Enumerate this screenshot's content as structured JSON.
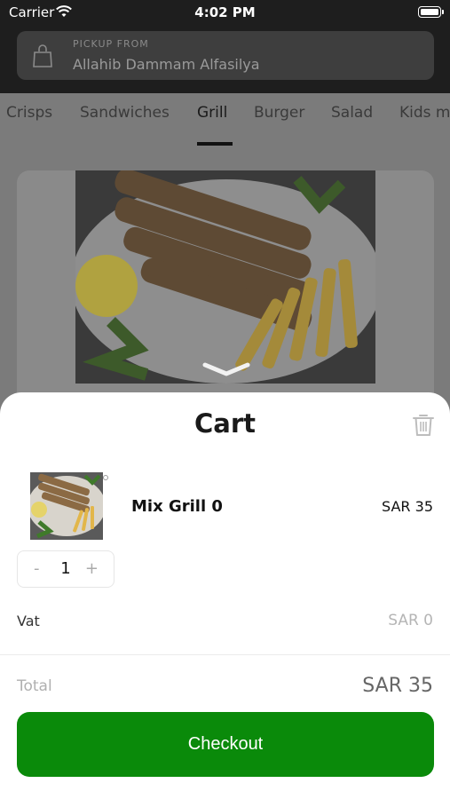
{
  "status_bar": {
    "carrier": "Carrier",
    "time": "4:02 PM"
  },
  "pickup": {
    "label": "PICKUP FROM",
    "location": "Allahib Dammam Alfasilya"
  },
  "category_tabs": [
    {
      "label": "Crisps"
    },
    {
      "label": "Sandwiches"
    },
    {
      "label": "Grill",
      "active": true
    },
    {
      "label": "Burger"
    },
    {
      "label": "Salad"
    },
    {
      "label": "Kids m"
    }
  ],
  "cart": {
    "title": "Cart",
    "items": [
      {
        "name": "Mix Grill 0",
        "price": "SAR 35",
        "quantity": "1",
        "minus": "-",
        "plus": "+"
      }
    ],
    "vat_label": "Vat",
    "vat_value": "SAR 0",
    "total_label": "Total",
    "total_value": "SAR 35",
    "checkout_label": "Checkout"
  },
  "colors": {
    "checkout_green": "#0a8a0a",
    "header_dark": "#1e1e1e"
  },
  "icons": [
    "wifi-icon",
    "battery-icon",
    "shopping-bag-icon",
    "chevron-down-icon",
    "trash-icon"
  ]
}
